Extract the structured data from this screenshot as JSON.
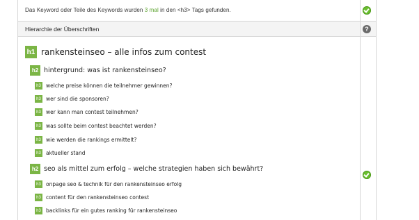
{
  "top_row": {
    "prefix": "Das Keyword oder Teile des Keywords wurden ",
    "count": "3 mal",
    "suffix": " in den <h3> Tags gefunden.",
    "status_icon": "check-icon"
  },
  "section": {
    "title": "Hierarchie der Überschriften",
    "help_icon": "?"
  },
  "headings": [
    {
      "level": "h1",
      "text": "rankensteinseo – alle infos zum contest"
    },
    {
      "level": "h2",
      "text": "hintergrund: was ist rankensteinseo?"
    },
    {
      "level": "h3",
      "text": "welche preise können die teilnehmer gewinnen?"
    },
    {
      "level": "h3",
      "text": "wer sind die sponsoren?"
    },
    {
      "level": "h3",
      "text": "wer kann man contest teilnehmen?"
    },
    {
      "level": "h3",
      "text": "was sollte beim contest beachtet werden?"
    },
    {
      "level": "h3",
      "text": "wie werden die rankings ermittelt?"
    },
    {
      "level": "h3",
      "text": "aktueller stand"
    },
    {
      "level": "h2",
      "text": "seo als mittel zum erfolg – welche strategien haben sich bewährt?"
    },
    {
      "level": "h3",
      "text": "onpage seo & technik für den rankensteinseo erfolg"
    },
    {
      "level": "h3",
      "text": "content für den rankensteinseo contest"
    },
    {
      "level": "h3",
      "text": "backlinks für ein gutes ranking für rankensteinseo"
    }
  ],
  "colors": {
    "badge": "#7bb545",
    "check": "#6abf2e",
    "highlight": "#58a12a"
  }
}
